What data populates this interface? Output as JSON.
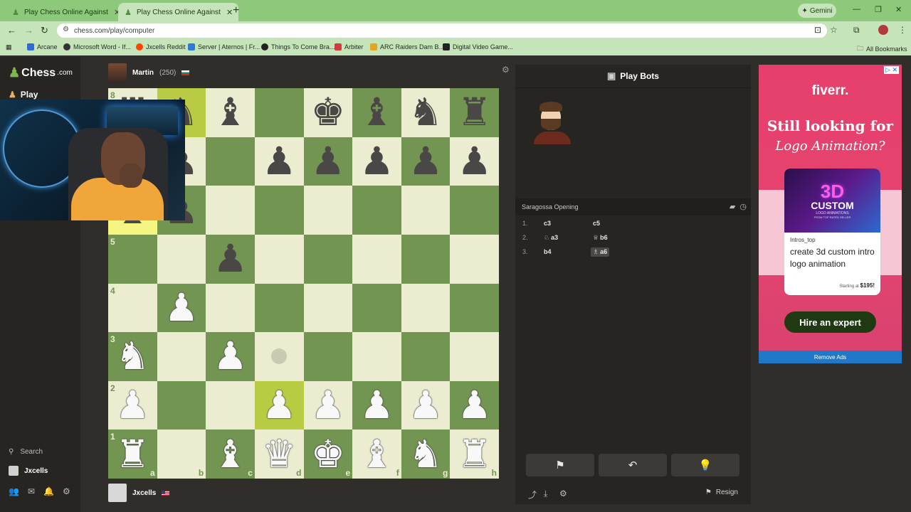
{
  "browser": {
    "tabs": [
      {
        "title": "Play Chess Online Against the C",
        "active": false
      },
      {
        "title": "Play Chess Online Against the C",
        "active": true
      }
    ],
    "gemini_label": "Gemini",
    "url": "chess.com/play/computer",
    "bookmarks": [
      "Arcane",
      "Microsoft Word - If...",
      "Jxcells Reddit",
      "Server | Aternos | Fr...",
      "Things To Come Bra...",
      "Arbiter",
      "ARC Raiders Dam B...",
      "Digital Video Game..."
    ],
    "all_bookmarks": "All Bookmarks"
  },
  "sidebar": {
    "logo": "Chess",
    "logo_suffix": ".com",
    "play": "Play",
    "search": "Search",
    "username": "Jxcells"
  },
  "top_player": {
    "name": "Martin",
    "rating": "(250)"
  },
  "bottom_player": {
    "name": "Jxcells"
  },
  "board": {
    "rows": [
      [
        "r",
        "n",
        "b",
        "",
        "k",
        "b",
        "n",
        "r"
      ],
      [
        "",
        "p",
        "",
        "p",
        "p",
        "p",
        "p",
        "p"
      ],
      [
        "b",
        "p",
        "",
        "",
        "",
        "",
        "",
        ""
      ],
      [
        "",
        "",
        "p",
        "",
        "",
        "",
        "",
        ""
      ],
      [
        "",
        "P",
        "",
        "",
        "",
        "",
        "",
        ""
      ],
      [
        "N",
        "",
        "P",
        "",
        "",
        "",
        "",
        ""
      ],
      [
        "P",
        "",
        "",
        "P",
        "P",
        "P",
        "P",
        "P"
      ],
      [
        "R",
        "",
        "B",
        "Q",
        "K",
        "B",
        "N",
        "R"
      ]
    ],
    "rank_labels": [
      "8",
      "7",
      "6",
      "5",
      "4",
      "3",
      "2",
      "1"
    ],
    "file_labels": [
      "a",
      "b",
      "c",
      "d",
      "e",
      "f",
      "g",
      "h"
    ],
    "highlights": [
      "b8",
      "a6"
    ],
    "last_move_to": "d2",
    "hint_square": "d3",
    "colors": {
      "light": "#ebecd0",
      "dark": "#739552"
    }
  },
  "panel": {
    "title": "Play Bots",
    "opening": "Saragossa Opening",
    "moves": [
      {
        "num": "1.",
        "white": "c3",
        "black": "c5",
        "white_piece": "",
        "black_piece": ""
      },
      {
        "num": "2.",
        "white": "a3",
        "black": "b6",
        "white_piece": "♘",
        "black_piece": "♕"
      },
      {
        "num": "3.",
        "white": "b4",
        "black": "a6",
        "white_piece": "",
        "black_piece": "♗"
      }
    ],
    "resign": "Resign"
  },
  "ad": {
    "brand": "fiverr.",
    "headline1": "Still looking for",
    "headline2": "Logo Animation?",
    "thumb_big": "3D",
    "thumb_title": "CUSTOM",
    "thumb_line2": "LOGO ANIMATIONS",
    "thumb_small": "FROM TOP RATED SELLER",
    "seller": "Intros_top",
    "description": "create 3d custom intro logo animation",
    "price_prefix": "Starting at",
    "price": "$195!",
    "cta": "Hire an expert",
    "remove": "Remove Ads"
  }
}
